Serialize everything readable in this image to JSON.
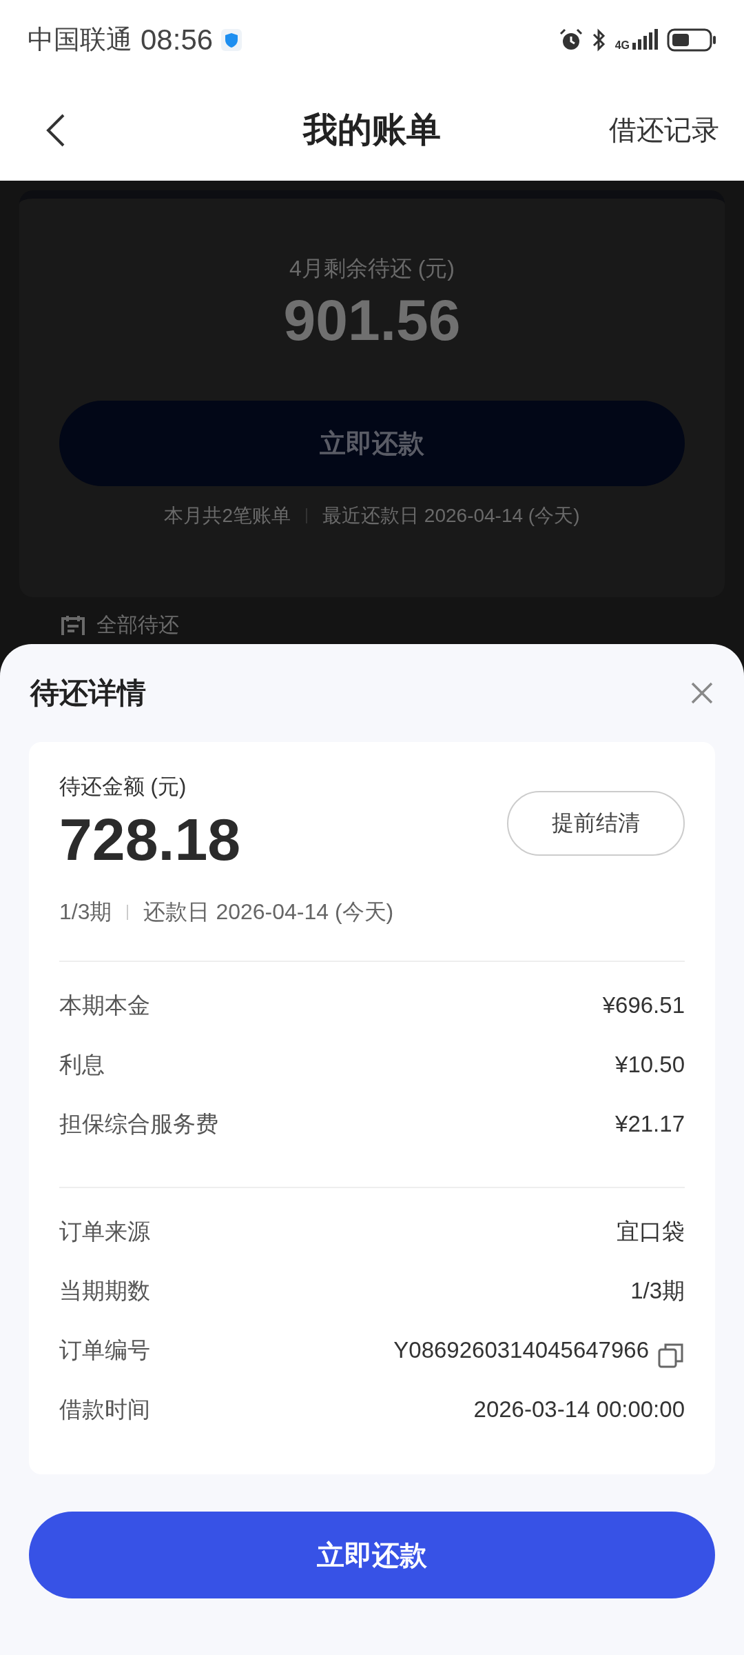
{
  "status_bar": {
    "carrier": "中国联通",
    "time": "08:56",
    "network": "4G"
  },
  "nav": {
    "title": "我的账单",
    "action": "借还记录"
  },
  "summary": {
    "label": "4月剩余待还 (元)",
    "amount": "901.56",
    "button": "立即还款",
    "count": "本月共2笔账单",
    "due": "最近还款日 2026-04-14 (今天)"
  },
  "filter": {
    "label": "全部待还"
  },
  "sheet": {
    "title": "待还详情",
    "amount_label": "待还金额 (元)",
    "amount": "728.18",
    "settle_button": "提前结清",
    "period": "1/3期",
    "due": "还款日 2026-04-14 (今天)",
    "charges": [
      {
        "label": "本期本金",
        "value": "¥696.51"
      },
      {
        "label": "利息",
        "value": "¥10.50"
      },
      {
        "label": "担保综合服务费",
        "value": "¥21.17"
      }
    ],
    "details": [
      {
        "label": "订单来源",
        "value": "宜口袋",
        "copyable": false
      },
      {
        "label": "当期期数",
        "value": "1/3期",
        "copyable": false
      },
      {
        "label": "订单编号",
        "value": "Y0869260314045647966",
        "copyable": true
      },
      {
        "label": "借款时间",
        "value": "2026-03-14 00:00:00",
        "copyable": false
      }
    ],
    "pay_button": "立即还款"
  }
}
